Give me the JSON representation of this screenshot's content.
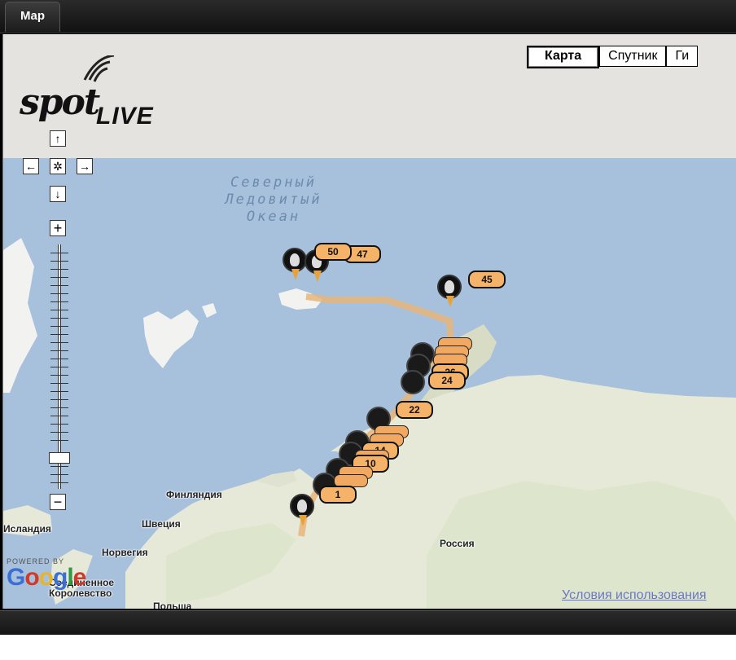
{
  "tab": {
    "label": "Map"
  },
  "maptypes": [
    "Карта",
    "Спутник",
    "Ги"
  ],
  "controls": {
    "pan_up": "↑",
    "pan_left": "←",
    "pan_center": "✲",
    "pan_right": "→",
    "pan_down": "↓",
    "zoom_in": "+",
    "zoom_out": "−"
  },
  "logo": {
    "main": "spot",
    "sub": "LIVE"
  },
  "ocean": {
    "line1": "Северный",
    "line2": "Ледовитый",
    "line3": "Океан"
  },
  "places": {
    "finland": "Финляндия",
    "sweden": "Швеция",
    "iceland": "Исландия",
    "norway": "Норвегия",
    "russia": "Россия",
    "uk": "Соединенное Королевство",
    "poland": "Польша"
  },
  "markers": {
    "m50": "50",
    "m47": "47",
    "m45": "45",
    "m26": "26",
    "m24": "24",
    "m22": "22",
    "m14": "14",
    "m10": "10",
    "m1": "1"
  },
  "google": {
    "powered": "POWERED BY",
    "word": "Google"
  },
  "terms": "Условия использования",
  "colors": {
    "sea": "#a7c0dc",
    "land": "#e6e8d8",
    "track": "#e8b57a",
    "badge": "#f5b36a"
  }
}
